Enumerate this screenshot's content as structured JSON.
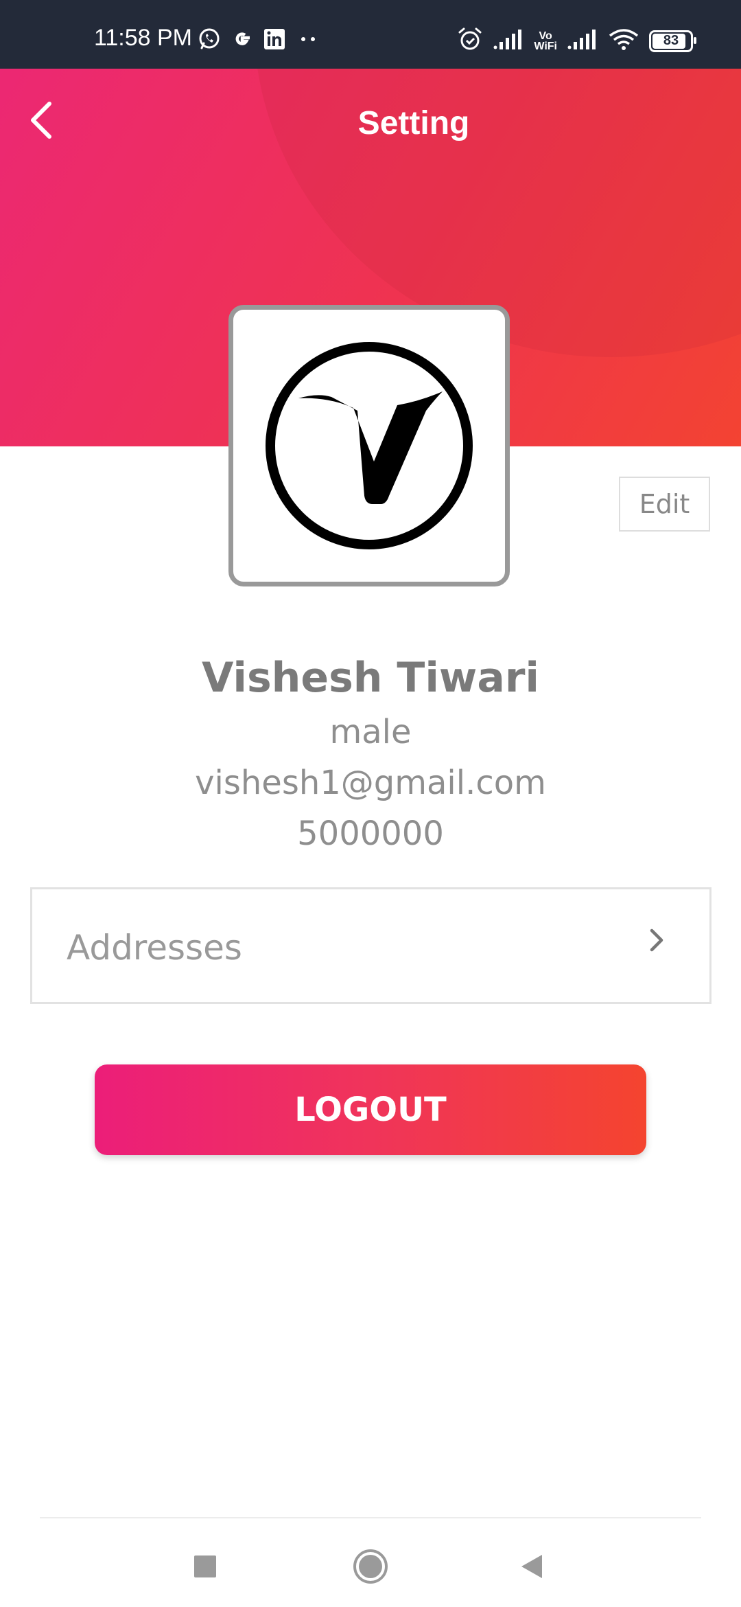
{
  "status_bar": {
    "time": "11:58 PM",
    "notification_icons": [
      "whatsapp-icon",
      "google-icon",
      "linkedin-icon",
      "more-dots-icon"
    ],
    "status_icons": [
      "alarm-icon",
      "signal-icon",
      "vowifi-icon",
      "signal-icon",
      "wifi-icon"
    ],
    "vowifi_label": "Vo\nWiFi",
    "battery_level": "83",
    "status_bar_color": "#232a39"
  },
  "header": {
    "title": "Setting",
    "back_icon": "chevron-left-icon",
    "gradient_start": "#ec2873",
    "gradient_end": "#f34332"
  },
  "profile": {
    "avatar_icon": "v-logo-icon",
    "edit_label": "Edit",
    "name": "Vishesh Tiwari",
    "gender": "male",
    "email": "vishesh1@gmail.com",
    "phone": "5000000"
  },
  "menu": {
    "addresses_label": "Addresses",
    "addresses_icon": "chevron-right-icon"
  },
  "actions": {
    "logout_label": "LOGOUT",
    "logout_gradient_start": "#ec1e79",
    "logout_gradient_end": "#f4442f"
  },
  "nav_bar": {
    "buttons": [
      "recents-square-icon",
      "home-circle-icon",
      "back-triangle-icon"
    ]
  }
}
